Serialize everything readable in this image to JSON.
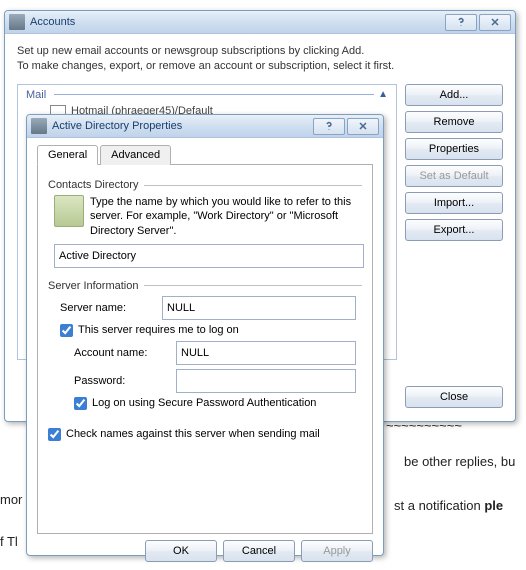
{
  "accounts": {
    "title": "Accounts",
    "intro_line1": "Set up new email accounts or newsgroup subscriptions by clicking Add.",
    "intro_line2": "To make changes, export, or remove an account or subscription, select it first.",
    "group_mail": "Mail",
    "item_hotmail": "Hotmail (phraeger45)/Default",
    "btn_add": "Add...",
    "btn_remove": "Remove",
    "btn_properties": "Properties",
    "btn_set_default": "Set as Default",
    "btn_import": "Import...",
    "btn_export": "Export...",
    "btn_close": "Close"
  },
  "props": {
    "title": "Active Directory Properties",
    "tab_general": "General",
    "tab_advanced": "Advanced",
    "section_contacts": "Contacts Directory",
    "contacts_desc": "Type the name by which you would like to refer to this server. For example, \"Work Directory\" or \"Microsoft Directory Server\".",
    "contacts_value": "Active Directory",
    "section_server": "Server Information",
    "label_server_name": "Server name:",
    "server_name_value": "NULL",
    "chk_logon": "This server requires me to log on",
    "label_account": "Account name:",
    "account_value": "NULL",
    "label_password": "Password:",
    "password_value": "",
    "chk_spa": "Log on using Secure Password Authentication",
    "chk_check_names": "Check names against this server when sending mail",
    "btn_ok": "OK",
    "btn_cancel": "Cancel",
    "btn_apply": "Apply"
  },
  "bg": {
    "t1": "~~~~~~~~~~",
    "t2": "be other replies, bu",
    "t3": "st a notification ple",
    "mor": "mor",
    "ft": "f Tl"
  }
}
